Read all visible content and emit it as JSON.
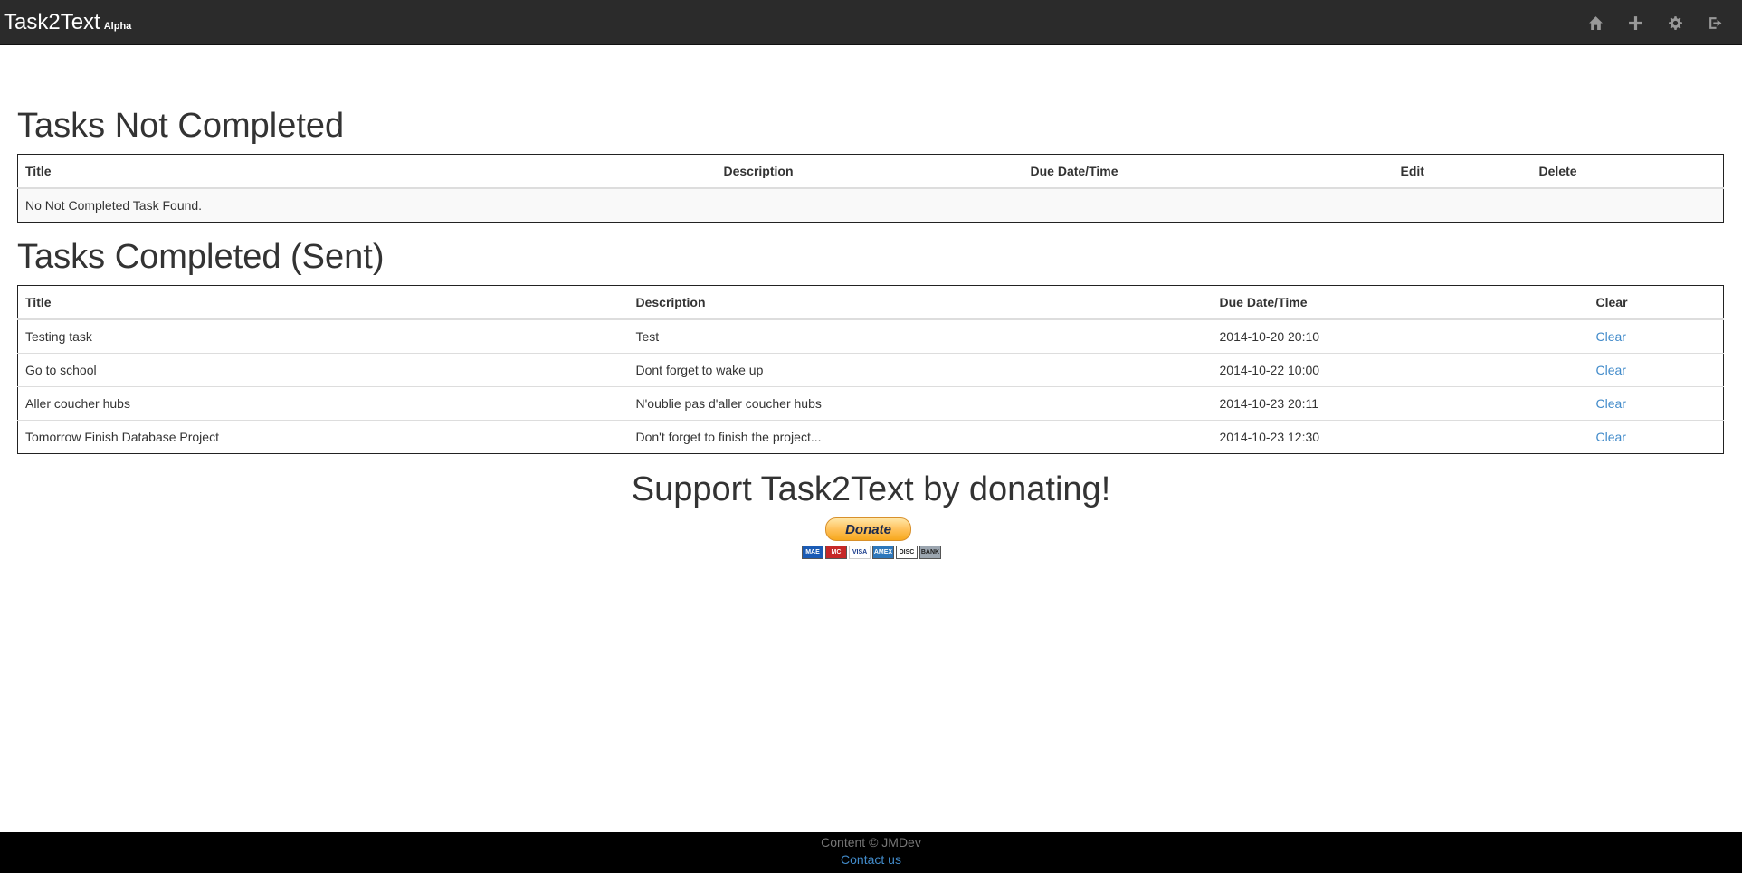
{
  "nav": {
    "brand": "Task2Text",
    "badge": "Alpha",
    "icons": [
      "home-icon",
      "plus-icon",
      "gear-icon",
      "logout-icon"
    ]
  },
  "not_completed": {
    "heading": "Tasks Not Completed",
    "columns": [
      "Title",
      "Description",
      "Due Date/Time",
      "Edit",
      "Delete"
    ],
    "empty_message": "No Not Completed Task Found."
  },
  "completed": {
    "heading": "Tasks Completed (Sent)",
    "columns": [
      "Title",
      "Description",
      "Due Date/Time",
      "Clear"
    ],
    "rows": [
      {
        "title": "Testing task",
        "description": "Test",
        "due": "2014-10-20 20:10",
        "action": "Clear"
      },
      {
        "title": "Go to school",
        "description": "Dont forget to wake up",
        "due": "2014-10-22 10:00",
        "action": "Clear"
      },
      {
        "title": "Aller coucher hubs",
        "description": "N'oublie pas d'aller coucher hubs",
        "due": "2014-10-23 20:11",
        "action": "Clear"
      },
      {
        "title": "Tomorrow Finish Database Project",
        "description": "Don't forget to finish the project...",
        "due": "2014-10-23 12:30",
        "action": "Clear"
      }
    ]
  },
  "donate": {
    "heading": "Support Task2Text by donating!",
    "button_label": "Donate",
    "cards": [
      {
        "label": "MAE",
        "color": "#1a5bb5"
      },
      {
        "label": "MC",
        "color": "#c62828"
      },
      {
        "label": "VISA",
        "color": "#ffffff"
      },
      {
        "label": "AMEX",
        "color": "#2e77bb"
      },
      {
        "label": "DISC",
        "color": "#ffffff"
      },
      {
        "label": "BANK",
        "color": "#9ca6b0"
      }
    ]
  },
  "footer": {
    "copyright": "Content © JMDev",
    "contact": "Contact us"
  },
  "colors": {
    "navbar": "#2b2b2b",
    "link": "#428bca",
    "footer": "#000000"
  }
}
